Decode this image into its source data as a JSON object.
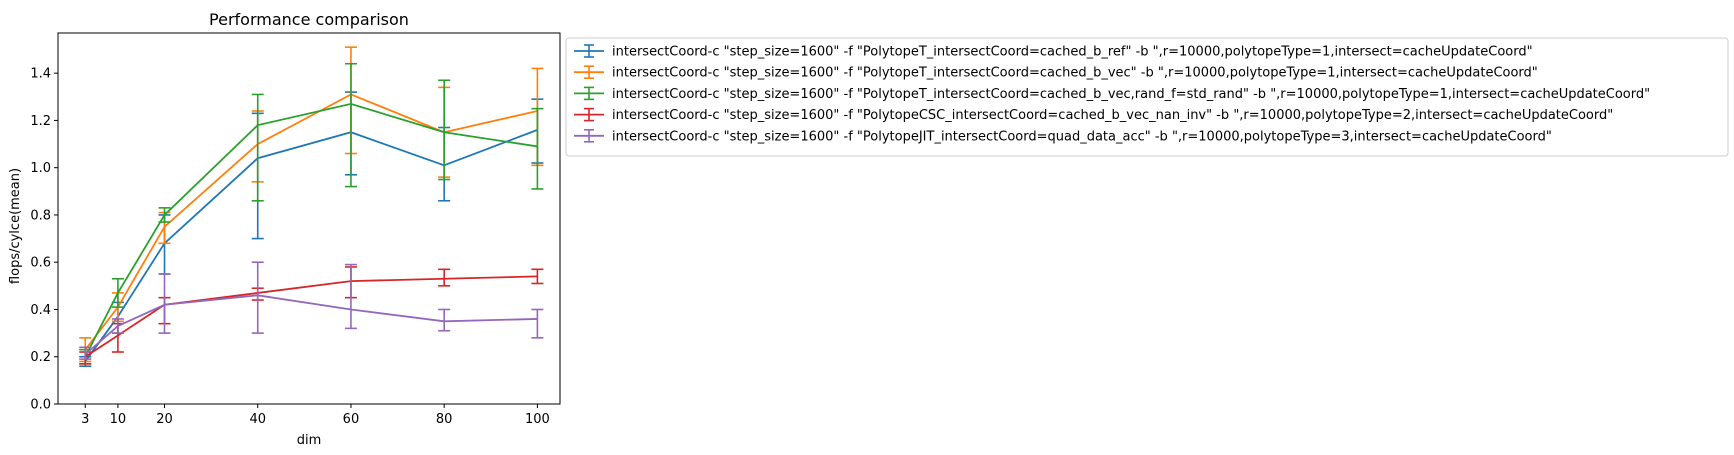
{
  "chart_data": {
    "type": "line",
    "title": "Performance comparison",
    "xlabel": "dim",
    "ylabel": "flops/cylce(mean)",
    "x": [
      3,
      10,
      20,
      40,
      60,
      80,
      100
    ],
    "xticks": [
      3,
      10,
      20,
      40,
      60,
      80,
      100
    ],
    "xlim": [
      -2.85,
      104.85
    ],
    "yticks": [
      0.0,
      0.2,
      0.4,
      0.6,
      0.8,
      1.0,
      1.2,
      1.4
    ],
    "ytick_labels": [
      "0.0",
      "0.2",
      "0.4",
      "0.6",
      "0.8",
      "1.0",
      "1.2",
      "1.4"
    ],
    "ylim": [
      0.0,
      1.57
    ],
    "grid": false,
    "legend_position": "outside-right-top",
    "error_bars": true,
    "series": [
      {
        "name": "intersectCoord-c \"step_size=1600\" -f \"PolytopeT_intersectCoord=cached_b_ref\" -b \",r=10000,polytopeType=1,intersect=cacheUpdateCoord\"",
        "color": "#1f77b4",
        "values": [
          0.18,
          0.37,
          0.68,
          1.04,
          1.15,
          1.01,
          1.16
        ],
        "err_low": [
          0.16,
          0.3,
          0.55,
          0.7,
          0.97,
          0.86,
          1.02
        ],
        "err_high": [
          0.2,
          0.43,
          0.8,
          1.23,
          1.32,
          1.17,
          1.29
        ]
      },
      {
        "name": "intersectCoord-c \"step_size=1600\" -f \"PolytopeT_intersectCoord=cached_b_vec\" -b \",r=10000,polytopeType=1,intersect=cacheUpdateCoord\"",
        "color": "#ff7f0e",
        "values": [
          0.23,
          0.41,
          0.75,
          1.1,
          1.31,
          1.15,
          1.24
        ],
        "err_low": [
          0.18,
          0.35,
          0.68,
          0.94,
          1.06,
          0.96,
          1.01
        ],
        "err_high": [
          0.28,
          0.47,
          0.81,
          1.24,
          1.51,
          1.34,
          1.42
        ]
      },
      {
        "name": "intersectCoord-c \"step_size=1600\" -f \"PolytopeT_intersectCoord=cached_b_vec,rand_f=std_rand\" -b \",r=10000,polytopeType=1,intersect=cacheUpdateCoord\"",
        "color": "#2ca02c",
        "values": [
          0.2,
          0.47,
          0.8,
          1.18,
          1.27,
          1.15,
          1.09
        ],
        "err_low": [
          0.17,
          0.41,
          0.77,
          0.86,
          0.92,
          0.95,
          0.91
        ],
        "err_high": [
          0.23,
          0.53,
          0.83,
          1.31,
          1.44,
          1.37,
          1.25
        ]
      },
      {
        "name": "intersectCoord-c \"step_size=1600\" -f \"PolytopeCSC_intersectCoord=cached_b_vec_nan_inv\" -b \",r=10000,polytopeType=2,intersect=cacheUpdateCoord\"",
        "color": "#d62728",
        "values": [
          0.2,
          0.29,
          0.42,
          0.47,
          0.52,
          0.53,
          0.54
        ],
        "err_low": [
          0.17,
          0.22,
          0.34,
          0.44,
          0.45,
          0.5,
          0.51
        ],
        "err_high": [
          0.22,
          0.34,
          0.45,
          0.49,
          0.58,
          0.57,
          0.57
        ]
      },
      {
        "name": "intersectCoord-c \"step_size=1600\" -f \"PolytopeJIT_intersectCoord=quad_data_acc\" -b \",r=10000,polytopeType=3,intersect=cacheUpdateCoord\"",
        "color": "#9467bd",
        "values": [
          0.21,
          0.33,
          0.42,
          0.46,
          0.4,
          0.35,
          0.36
        ],
        "err_low": [
          0.19,
          0.3,
          0.3,
          0.3,
          0.32,
          0.31,
          0.28
        ],
        "err_high": [
          0.24,
          0.36,
          0.55,
          0.6,
          0.59,
          0.4,
          0.4
        ]
      }
    ]
  }
}
